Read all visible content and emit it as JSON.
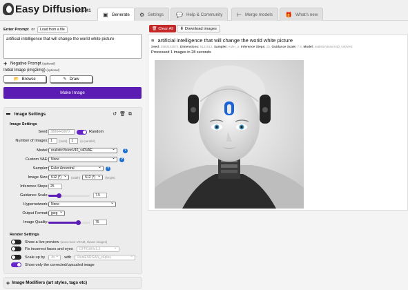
{
  "app": {
    "title": "Easy Diffusion",
    "version": "v2.5.41"
  },
  "tabs": [
    {
      "label": "Generate",
      "icon": "image-icon"
    },
    {
      "label": "Settings",
      "icon": "gear-icon"
    },
    {
      "label": "Help & Community",
      "icon": "comments-icon"
    },
    {
      "label": "Merge models",
      "icon": "merge-icon"
    },
    {
      "label": "What's new",
      "icon": "gift-icon"
    }
  ],
  "prompt": {
    "label": "Enter Prompt",
    "or": "or",
    "load_file": "Load from a file",
    "value": "artificial intelligence that will change the world white picture"
  },
  "negative": {
    "label": "Negative Prompt",
    "optional": "(optional)"
  },
  "init_image": {
    "label": "Initial Image (img2img)",
    "optional": "(optional)",
    "browse": "Browse",
    "draw": "Draw"
  },
  "make_button": "Make Image",
  "image_settings": {
    "title": "Image Settings",
    "section": "Image Settings",
    "seed": {
      "label": "Seed:",
      "value": "3880443870",
      "random_label": "Random",
      "random_on": true
    },
    "num_images": {
      "label": "Number of Images:",
      "total": "1",
      "total_hint": "(total)",
      "parallel": "1",
      "parallel_hint": "(in parallel)"
    },
    "model": {
      "label": "Model:",
      "value": "realisticVisionV40_v40VAE"
    },
    "vae": {
      "label": "Custom VAE:",
      "value": "None"
    },
    "sampler": {
      "label": "Sampler:",
      "value": "Euler Ancestral"
    },
    "size": {
      "label": "Image Size:",
      "width": "512 (*)",
      "width_hint": "(width)",
      "height": "512 (*)",
      "height_hint": "(height)"
    },
    "steps": {
      "label": "Inference Steps:",
      "value": "25"
    },
    "guidance": {
      "label": "Guidance Scale:",
      "value": "7.5",
      "fraction": 0.25
    },
    "hypernetwork": {
      "label": "Hypernetwork:",
      "value": "None"
    },
    "format": {
      "label": "Output Format:",
      "value": "jpeg"
    },
    "quality": {
      "label": "Image Quality:",
      "value": "75",
      "fraction": 0.72
    }
  },
  "render_settings": {
    "title": "Render Settings",
    "live_preview": {
      "label": "Show a live preview",
      "hint": "(uses more VRAM, slower images)"
    },
    "fix_faces": {
      "label": "Fix incorrect faces and eyes",
      "model": "GFPGANv1.3"
    },
    "upscale": {
      "label": "Scale up by",
      "factor": "4x",
      "with": "with",
      "model": "RealESRGAN_x4plus"
    },
    "only_corrected": {
      "label": "Show only the corrected/upscaled image"
    }
  },
  "modifiers": {
    "label": "Image Modifiers (art styles, tags etc)"
  },
  "output": {
    "clear_all": "Clear All",
    "download": "Download images",
    "prompt": "artificial intelligence that will change the world white picture",
    "meta": [
      {
        "k": "Seed:",
        "v": "3880443870,"
      },
      {
        "k": "Dimensions:",
        "v": "512x512,"
      },
      {
        "k": "Sampler:",
        "v": "euler_a,"
      },
      {
        "k": "Inference Steps:",
        "v": "25,"
      },
      {
        "k": "Guidance Scale:",
        "v": "7.5,"
      },
      {
        "k": "Model:",
        "v": "realisticVisionV40_v40VAE"
      }
    ],
    "processed": "Processed 1 images in 28 seconds"
  },
  "colors": {
    "accent": "#5b1cb4",
    "danger": "#c62828",
    "info": "#1c6dd0"
  }
}
